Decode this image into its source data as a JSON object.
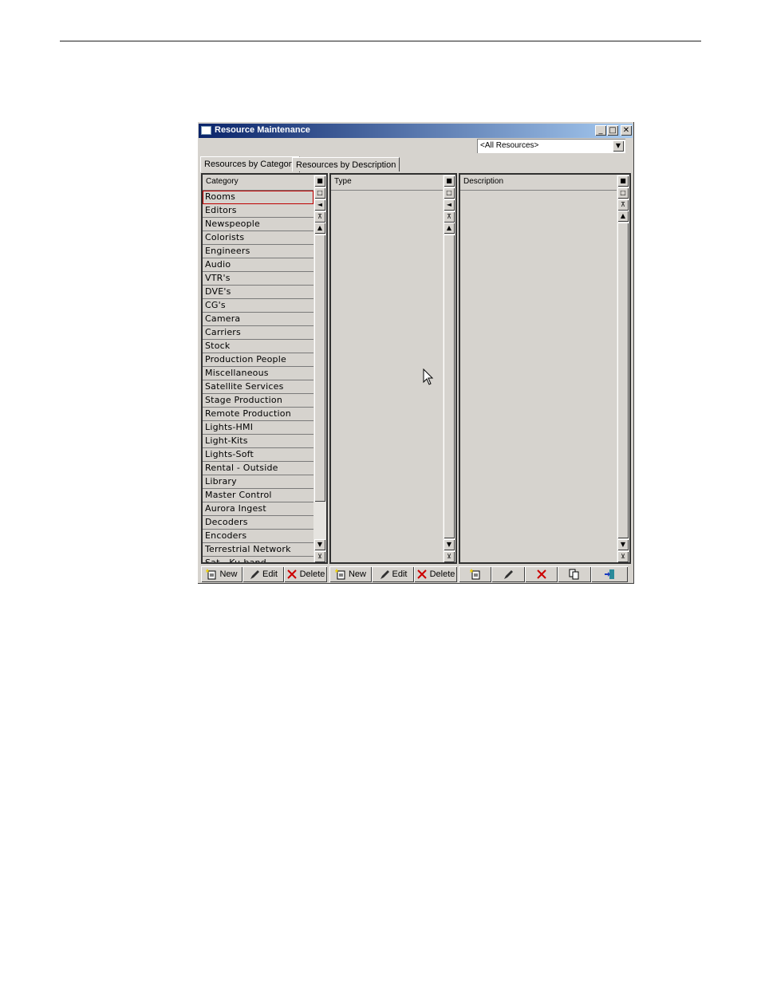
{
  "window": {
    "title": "Resource Maintenance",
    "minimize": "_",
    "maximize": "□",
    "close": "✕"
  },
  "filter": {
    "selected": "<All Resources>"
  },
  "tabs": [
    "Resources by Category",
    "Resources by Description"
  ],
  "category_panel": {
    "header": "Category",
    "items": [
      "Rooms",
      "Editors",
      "Newspeople",
      "Colorists",
      "Engineers",
      "Audio",
      "VTR's",
      "DVE's",
      "CG's",
      "Camera",
      "Carriers",
      "Stock",
      "Production People",
      "Miscellaneous",
      "Satellite Services",
      "Stage Production",
      "Remote Production",
      "Lights-HMI",
      "Light-Kits",
      "Lights-Soft",
      "Rental - Outside",
      "Library",
      "Master Control",
      "Aurora Ingest",
      "Decoders",
      "Encoders",
      "Terrestrial Network",
      "Sat - Ku-band"
    ],
    "selected": "Rooms"
  },
  "type_panel": {
    "header": "Type"
  },
  "description_panel": {
    "header": "Description"
  },
  "buttons": {
    "new": "New",
    "edit": "Edit",
    "delete": "Delete"
  },
  "icons": {
    "new": "new-document-icon",
    "edit": "pencil-icon",
    "delete": "red-x-icon",
    "copy": "copy-icon",
    "exit": "exit-door-icon"
  },
  "colors": {
    "title_start": "#0a246a",
    "title_end": "#a6caf0",
    "selection_outline": "#c00000",
    "delete_x": "#cc0000"
  }
}
